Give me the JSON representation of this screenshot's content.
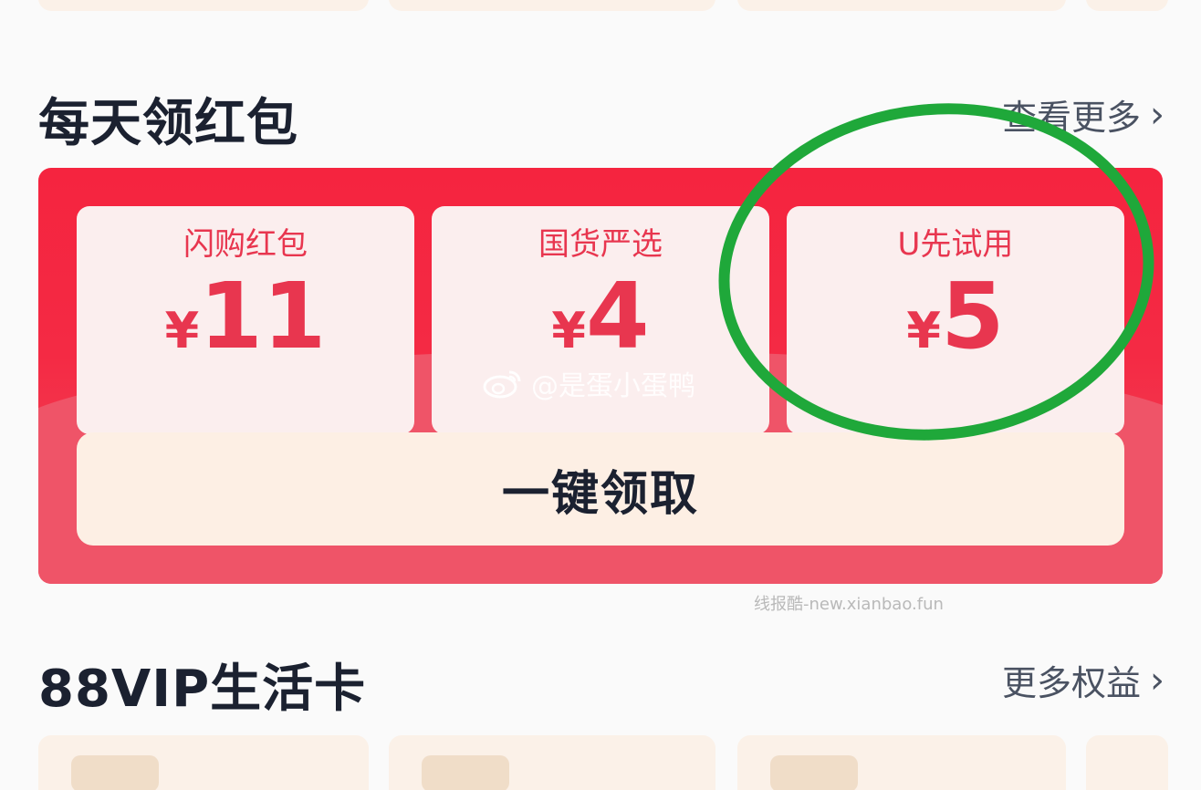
{
  "red_packet_section": {
    "title": "每天领红包",
    "more_label": "查看更多",
    "coupons": [
      {
        "name": "闪购红包",
        "currency": "¥",
        "amount": "11"
      },
      {
        "name": "国货严选",
        "currency": "¥",
        "amount": "4"
      },
      {
        "name": "U先试用",
        "currency": "¥",
        "amount": "5"
      }
    ],
    "claim_button": "一键领取"
  },
  "life_card_section": {
    "title": "88VIP生活卡",
    "more_label": "更多权益"
  },
  "watermarks": {
    "weibo": "@是蛋小蛋鸭",
    "site": "线报酷-new.xianbao.fun"
  },
  "colors": {
    "accent_red": "#f5243f",
    "coupon_text": "#e8364f",
    "annotation_green": "#1fa83a"
  },
  "icons": {
    "more_chevron": "chevron-right-icon",
    "weibo_logo": "weibo-icon"
  }
}
